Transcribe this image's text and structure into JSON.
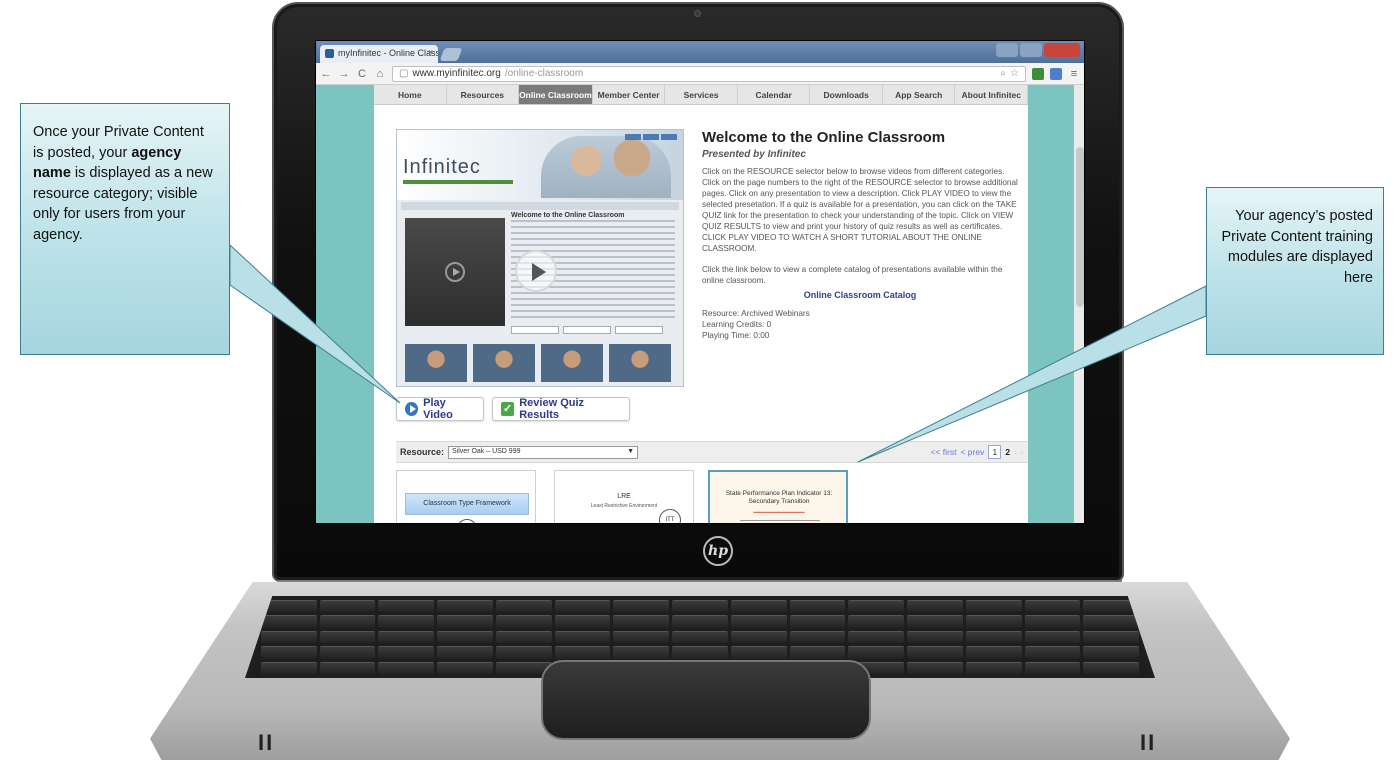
{
  "browser": {
    "tab_title": "myInfinitec - Online Class",
    "tab_close": "×",
    "url_domain": "www.myinfinitec.org",
    "url_path": "/online-classroom"
  },
  "site_nav": [
    "Home",
    "Resources",
    "Online Classroom",
    "Member Center",
    "Services",
    "Calendar",
    "Downloads",
    "App Search",
    "About Infinitec"
  ],
  "site_nav_active": "Online Classroom",
  "preview": {
    "logo": "Infinitec",
    "inner_title": "Welcome to the Online Classroom"
  },
  "welcome": {
    "title": "Welcome to the Online Classroom",
    "subtitle": "Presented by Infinitec",
    "paragraph1": "Click on the RESOURCE selector below to browse videos from different categories. Click on the page numbers to the right of the RESOURCE selector to browse additional pages. Click on any presentation to view a description. Click PLAY VIDEO to view the selected presetation. If a quiz is available for a presentation, you can click on the TAKE QUIZ link for the presentation to check your understanding of the topic. Click on VIEW QUIZ RESULTS to view and print your history of quiz results as well as certificates. CLICK PLAY VIDEO TO WATCH A SHORT TUTORIAL ABOUT THE ONLINE CLASSROOM.",
    "paragraph2": "Click the link below to view a complete catalog of presentations available within the online classroom.",
    "catalog_link": "Online Classroom Catalog",
    "resource_line": "Resource: Archived Webinars",
    "credits_line": "Learning Credits: 0",
    "time_line": "Playing Time: 0:00"
  },
  "buttons": {
    "play_video": "Play Video",
    "review_quiz": "Review Quiz Results"
  },
  "resource_bar": {
    "label": "Resource:",
    "selected": "Silver Oak – USD 999",
    "arrow": "▼",
    "first": "<< first",
    "prev": "< prev",
    "page1": "1",
    "page2": "2"
  },
  "cards": {
    "card1_title": "Classroom Type Framework",
    "card2_title": "LRE",
    "card2_sub": "Least Restrictive Environment",
    "card3_title": "State Performance Plan Indicator 13: Secondary Transition"
  },
  "callouts": {
    "left_pre": "Once your Private Content is posted, your ",
    "left_bold": "agency name",
    "left_post": " is displayed as a new resource category; visible only for users from your agency.",
    "right": "Your agency’s posted Private Content training modules are displayed here"
  },
  "laptop": {
    "logo": "hp",
    "mark_left": "II",
    "mark_right": "II"
  },
  "colors": {
    "page_teal": "#7cc4bf",
    "callout_border": "#3d7f8f",
    "link_blue": "#2e3f8f"
  }
}
